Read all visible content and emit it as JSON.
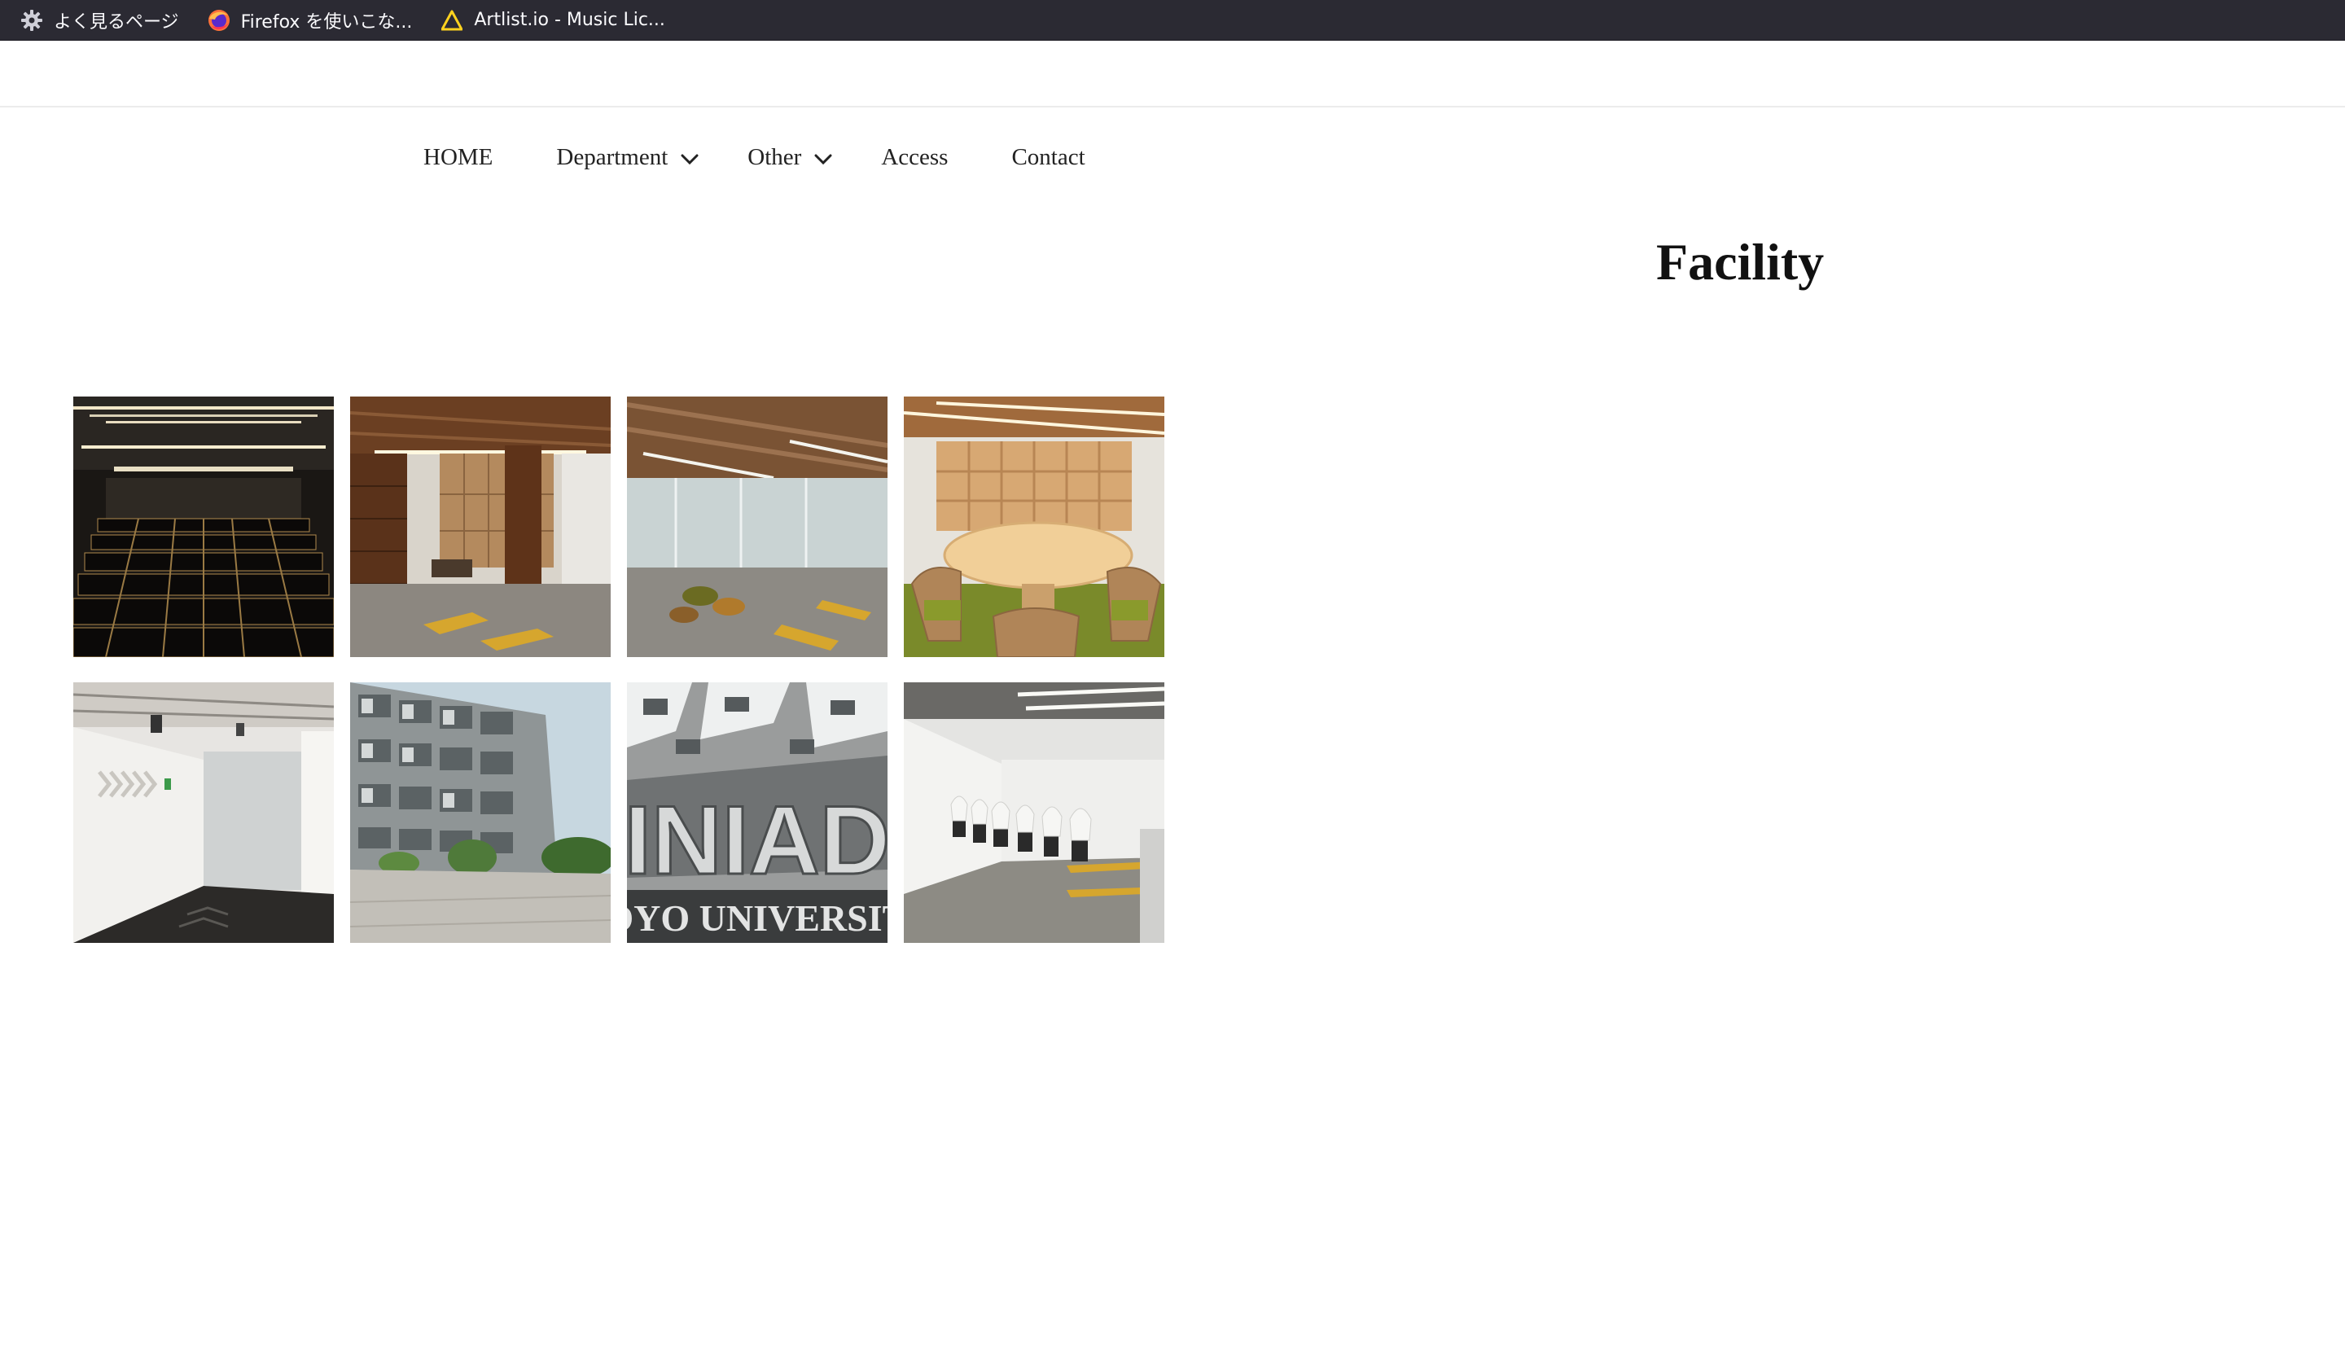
{
  "bookmarks": [
    {
      "icon": "gear-icon",
      "label": "よく見るページ"
    },
    {
      "icon": "firefox-icon",
      "label": "Firefox を使いこな..."
    },
    {
      "icon": "artlist-triangle-icon",
      "label": "Artlist.io - Music Lic..."
    }
  ],
  "nav": {
    "home": "HOME",
    "department": "Department",
    "other": "Other",
    "access": "Access",
    "contact": "Contact"
  },
  "page": {
    "title": "Facility"
  },
  "gallery": {
    "photos": [
      {
        "subject": "auditorium-seats"
      },
      {
        "subject": "wood-library-lounge"
      },
      {
        "subject": "glass-corridor-lounge"
      },
      {
        "subject": "round-table-bookshelf"
      },
      {
        "subject": "white-corridor-arrows"
      },
      {
        "subject": "building-exterior"
      },
      {
        "subject": "iniad-toyo-university-sign"
      },
      {
        "subject": "computer-room"
      }
    ],
    "sign_text": "INIAD",
    "sign_subtext": "TOYO UNIVERSITY"
  },
  "colors": {
    "bookmarks_bg": "#2b2a33",
    "text": "#222222",
    "accent_yellow": "#d6a62e",
    "wood": "#6b3f22"
  }
}
